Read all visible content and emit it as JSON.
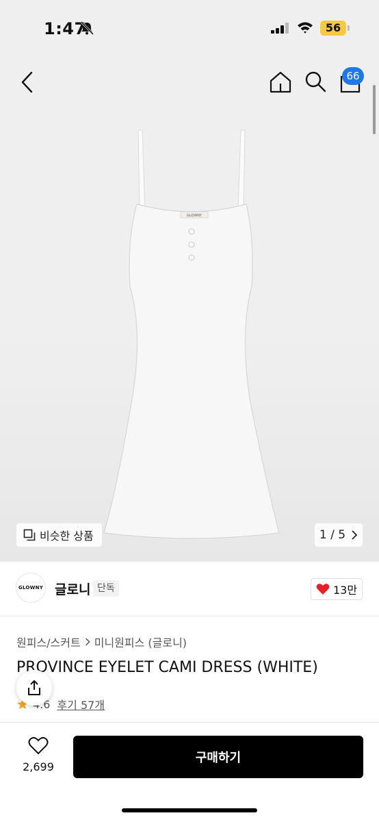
{
  "status_bar": {
    "time": "1:47",
    "battery": "56"
  },
  "header": {
    "cart_count": "66"
  },
  "image": {
    "brand_label": "GLOWNY",
    "similar_label": "비슷한 상품",
    "page": "1 / 5"
  },
  "brand": {
    "logo_text": "GLOWNY",
    "name": "글로니",
    "tag": "단독",
    "likes": "13만"
  },
  "breadcrumb": {
    "category": "원피스/스커트",
    "subcategory": "미니원피스 (글로니)"
  },
  "product": {
    "title": "PROVINCE EYELET CAMI DRESS (WHITE)",
    "rating": "4.6",
    "review_label": "후기 57개"
  },
  "bottom": {
    "wish_count": "2,699",
    "buy_label": "구매하기"
  },
  "colors": {
    "accent_badge": "#1f78e6",
    "heart": "#e8202a",
    "star": "#f5a623",
    "buy_bg": "#000000"
  }
}
